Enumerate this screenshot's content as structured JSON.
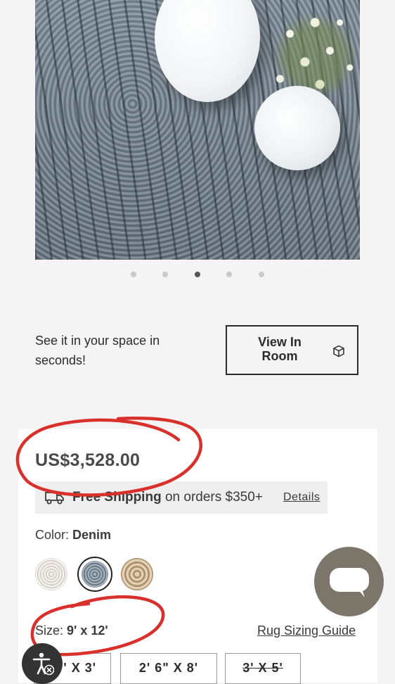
{
  "carousel": {
    "slide_count": 5,
    "active_index": 2
  },
  "view_in_room": {
    "prompt": "See it in your space in seconds!",
    "button_label": "View In Room",
    "icon": "cube-icon"
  },
  "product": {
    "price": "US$3,528.00",
    "shipping": {
      "bold": "Free Shipping",
      "rest": " on orders $350+",
      "details_link": "Details",
      "icon": "truck-icon"
    },
    "color": {
      "label": "Color: ",
      "value": "Denim"
    },
    "swatches": [
      {
        "name": "ivory",
        "selected": false
      },
      {
        "name": "denim",
        "selected": true
      },
      {
        "name": "natural",
        "selected": false
      }
    ],
    "size": {
      "label": "Size: ",
      "value": "9' x 12'"
    },
    "sizing_guide": "Rug Sizing Guide",
    "size_options": [
      "' X 3'",
      "2' 6\" X 8'",
      "3' X 5'"
    ]
  },
  "colors": {
    "annotation_red": "#d9302c",
    "chat_button": "#7c7569",
    "selected_outline": "#222222"
  },
  "chat": {
    "icon": "chat-bubble-icon"
  },
  "accessibility": {
    "icon": "accessibility-icon"
  }
}
